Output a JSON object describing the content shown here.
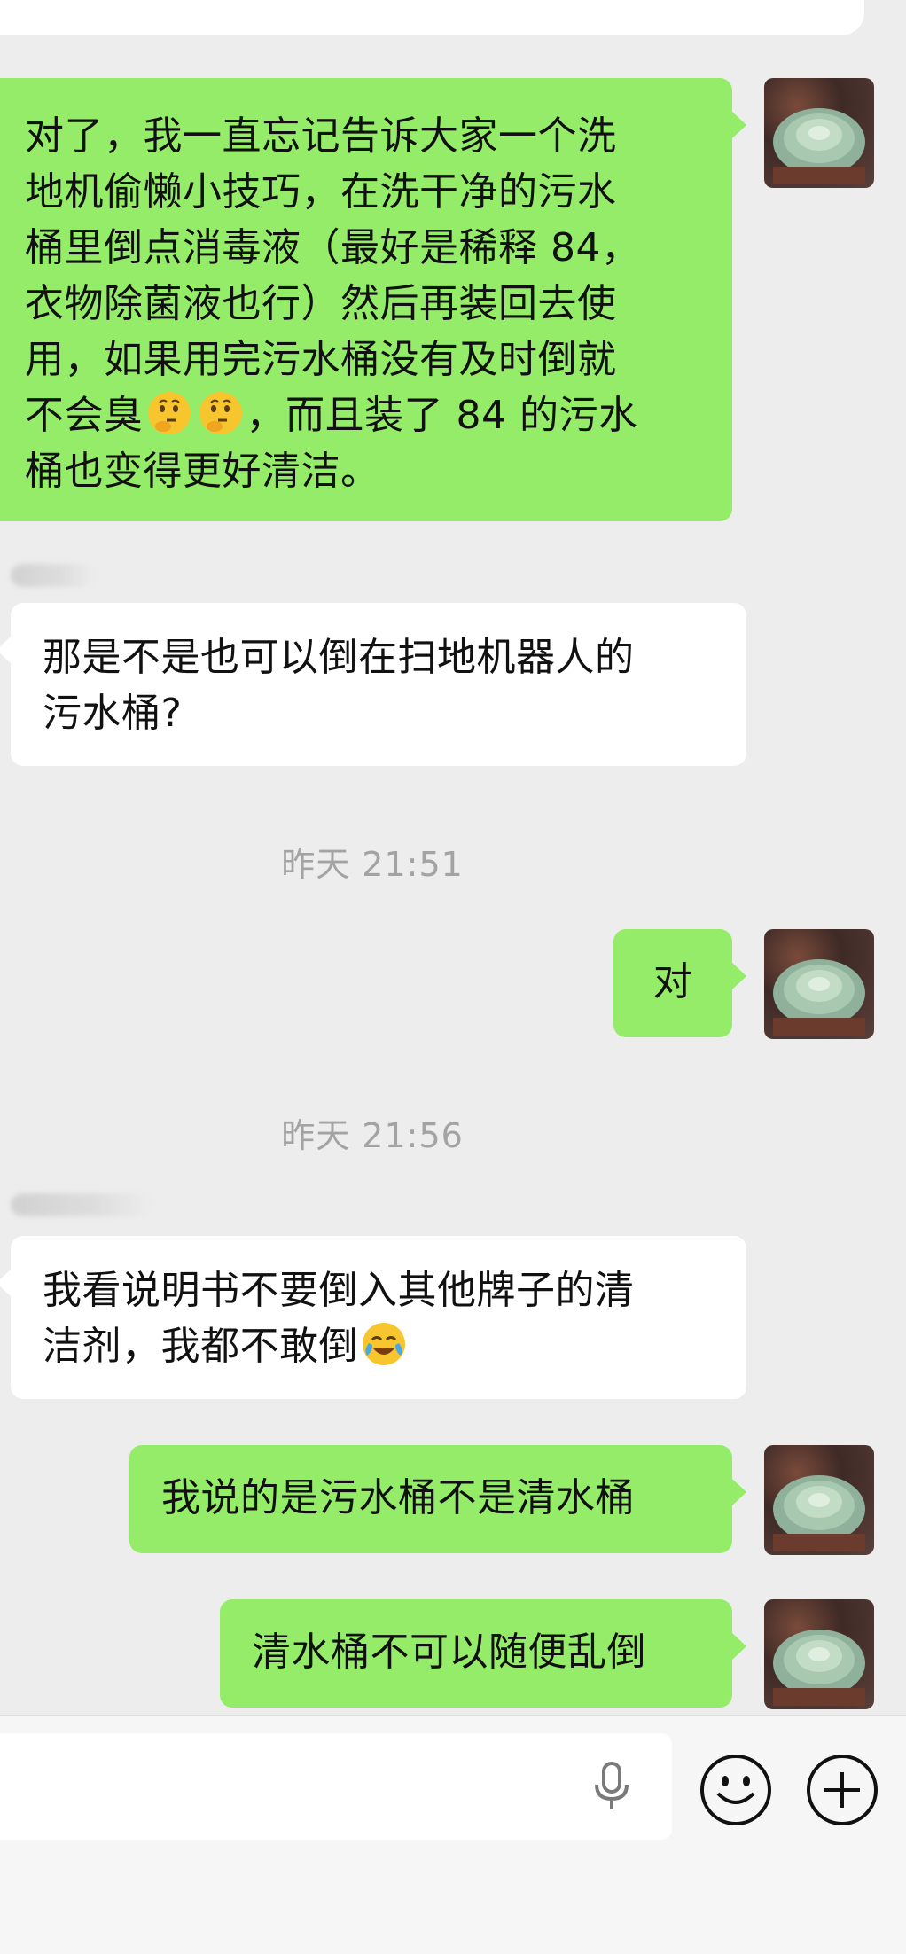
{
  "messages": [
    {
      "id": 1,
      "side": "me",
      "text_lines": [
        "对了，我一直忘记告诉大家一个洗",
        "地机偷懒小技巧，在洗干净的污水",
        "桶里倒点消毒液（最好是稀释 84，",
        "衣物除菌液也行）然后再装回去使",
        "用，如果用完污水桶没有及时倒就"
      ],
      "line6_before": "不会臭",
      "line6_after": "，而且装了 84 的污水",
      "line7": "桶也变得更好清洁。"
    },
    {
      "id": 2,
      "side": "other",
      "text_lines": [
        "那是不是也可以倒在扫地机器人的",
        "污水桶?"
      ]
    },
    {
      "id": 3,
      "side": "me",
      "text": "对"
    },
    {
      "id": 4,
      "side": "other",
      "line1": "我看说明书不要倒入其他牌子的清",
      "line2_before": "洁剂，我都不敢倒"
    },
    {
      "id": 5,
      "side": "me",
      "text": "我说的是污水桶不是清水桶"
    },
    {
      "id": 6,
      "side": "me",
      "text": "清水桶不可以随便乱倒"
    }
  ],
  "timestamps": [
    "昨天 21:51",
    "昨天 21:56"
  ],
  "icons": {
    "thinking": "thinking-face-emoji",
    "crying": "crying-laughing-emoji",
    "mic": "microphone-icon",
    "emoji_button": "smiley-face-icon",
    "more_button": "plus-circle-icon"
  },
  "colors": {
    "my_bubble": "#95ec69",
    "other_bubble": "#ffffff",
    "background": "#ededed",
    "timestamp": "#a3a3a3"
  }
}
